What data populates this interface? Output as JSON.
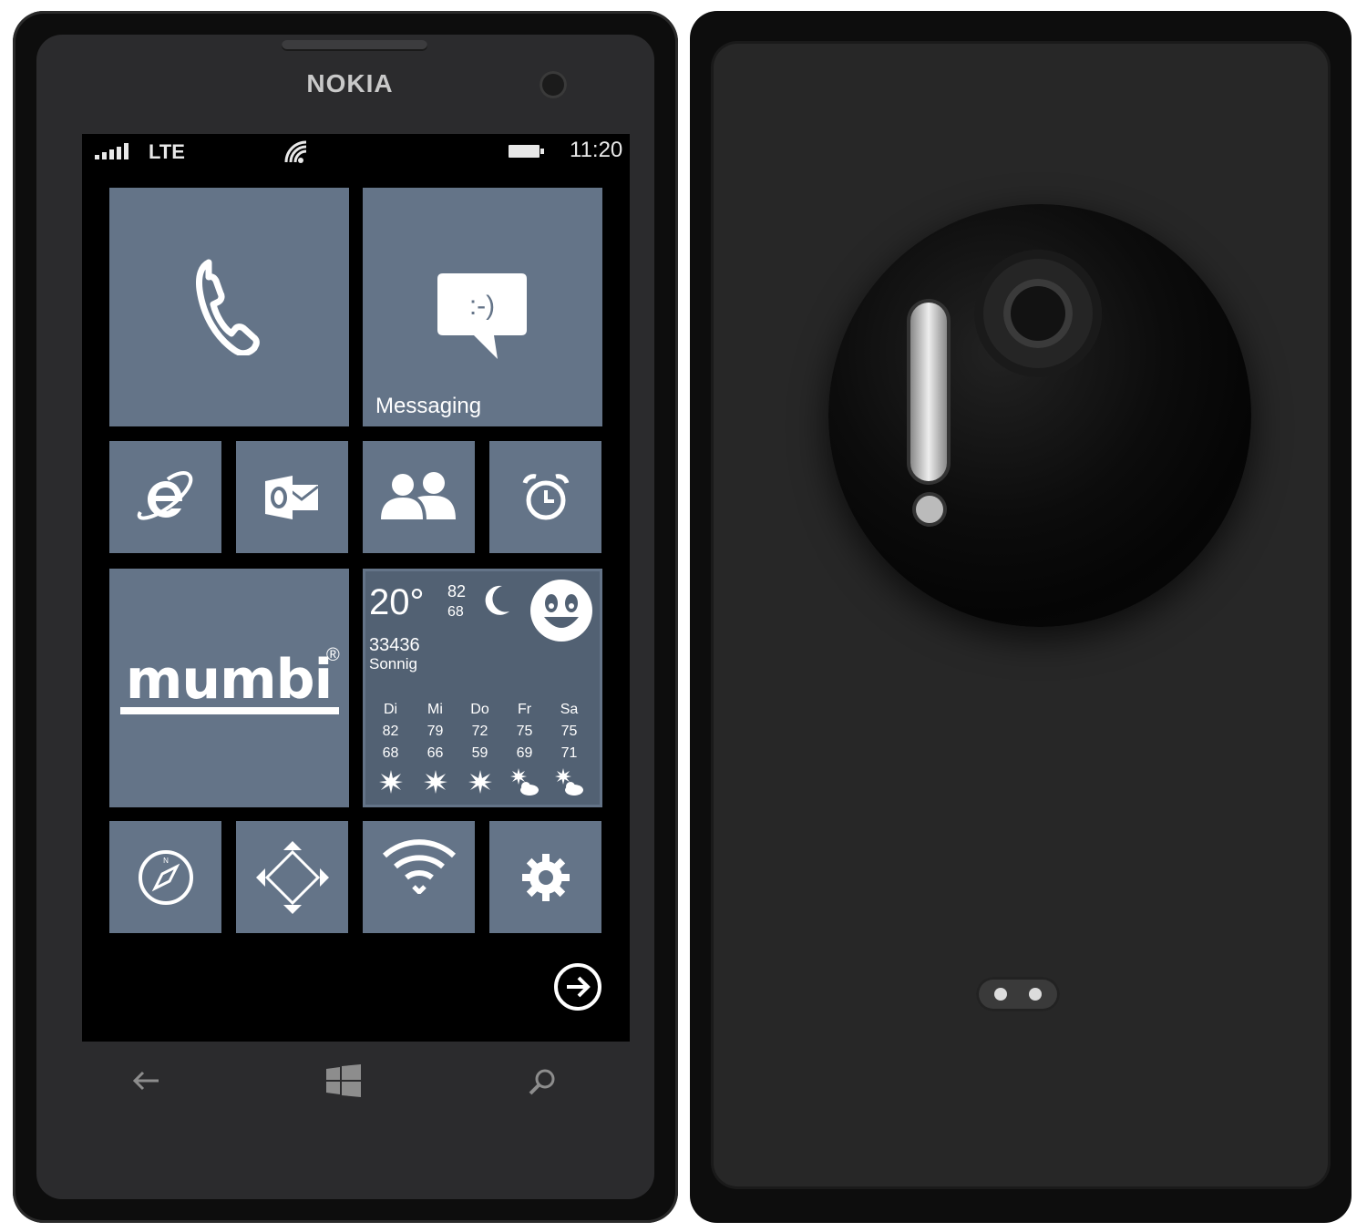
{
  "device": {
    "brand": "NOKIA"
  },
  "status_bar": {
    "network": "LTE",
    "time": "11:20"
  },
  "tiles": {
    "messaging_label": "Messaging",
    "logo_text": "mumbi",
    "logo_mark": "®",
    "messaging_glyph": ":-)"
  },
  "weather": {
    "temp": "20°",
    "high": "82",
    "low": "68",
    "zip": "33436",
    "condition": "Sonnig",
    "forecast": [
      {
        "day": "Di",
        "high": "82",
        "low": "68"
      },
      {
        "day": "Mi",
        "high": "79",
        "low": "66"
      },
      {
        "day": "Do",
        "high": "72",
        "low": "59"
      },
      {
        "day": "Fr",
        "high": "75",
        "low": "69"
      },
      {
        "day": "Sa",
        "high": "75",
        "low": "71"
      }
    ]
  },
  "icons": {
    "phone": "phone-icon",
    "messaging": "chat-bubble-icon",
    "browser": "internet-explorer-icon",
    "outlook": "outlook-icon",
    "people": "people-icon",
    "alarm": "alarm-clock-icon",
    "compass": "compass-icon",
    "maps": "maps-navigation-icon",
    "wifi": "wifi-icon",
    "settings": "gear-icon",
    "next": "arrow-right-circle-icon",
    "back": "back-arrow-icon",
    "start": "windows-logo-icon",
    "search": "search-icon"
  },
  "colors": {
    "tile": "#647488",
    "weather_tile": "#526173",
    "screen_bg": "#000000",
    "body": "#2b2b2d"
  }
}
